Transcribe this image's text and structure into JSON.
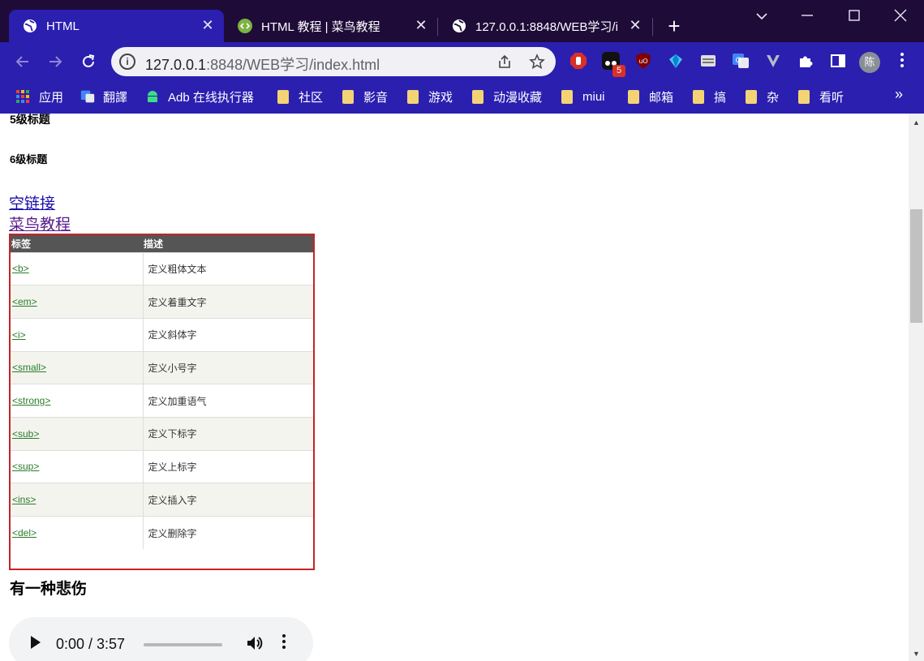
{
  "browser": {
    "tabs": [
      {
        "title": "HTML",
        "active": true
      },
      {
        "title": "HTML 教程 | 菜鸟教程",
        "active": false
      },
      {
        "title": "127.0.0.1:8848/WEB学习/i",
        "active": false
      }
    ],
    "close_glyph": "✕",
    "new_tab_glyph": "+",
    "address": {
      "host": "127.0.0.1",
      "rest": ":8848/WEB学习/index.html"
    },
    "extension_badge": "5",
    "profile_initial": "陈",
    "bookmarks": [
      "应用",
      "翻譯",
      "Adb 在线执行器",
      "社区",
      "影音",
      "游戏",
      "动漫收藏",
      "miui",
      "邮箱",
      "搞",
      "杂",
      "看听"
    ],
    "bookmarks_more": "»"
  },
  "page": {
    "h5": "5级标题",
    "h6": "6级标题",
    "link_empty": "空链接",
    "link_runoob": "菜鸟教程",
    "table": {
      "headers": [
        "标签",
        "描述"
      ],
      "rows": [
        {
          "tag": "<b>",
          "desc": "定义粗体文本"
        },
        {
          "tag": "<em>",
          "desc": "定义着重文字"
        },
        {
          "tag": "<i>",
          "desc": "定义斜体字"
        },
        {
          "tag": "<small>",
          "desc": "定义小号字"
        },
        {
          "tag": "<strong>",
          "desc": "定义加重语气"
        },
        {
          "tag": "<sub>",
          "desc": "定义下标字"
        },
        {
          "tag": "<sup>",
          "desc": "定义上标字"
        },
        {
          "tag": "<ins>",
          "desc": "定义插入字"
        },
        {
          "tag": "<del>",
          "desc": "定义删除字"
        }
      ]
    },
    "song_title": "有一种悲伤",
    "audio": {
      "time": "0:00 / 3:57"
    }
  },
  "colors": {
    "tab_bar": "#1e0b38",
    "toolbar": "#2b1fb0",
    "highlight_border": "#c42525",
    "table_header": "#555555",
    "tag_link": "#2a7d2a"
  }
}
